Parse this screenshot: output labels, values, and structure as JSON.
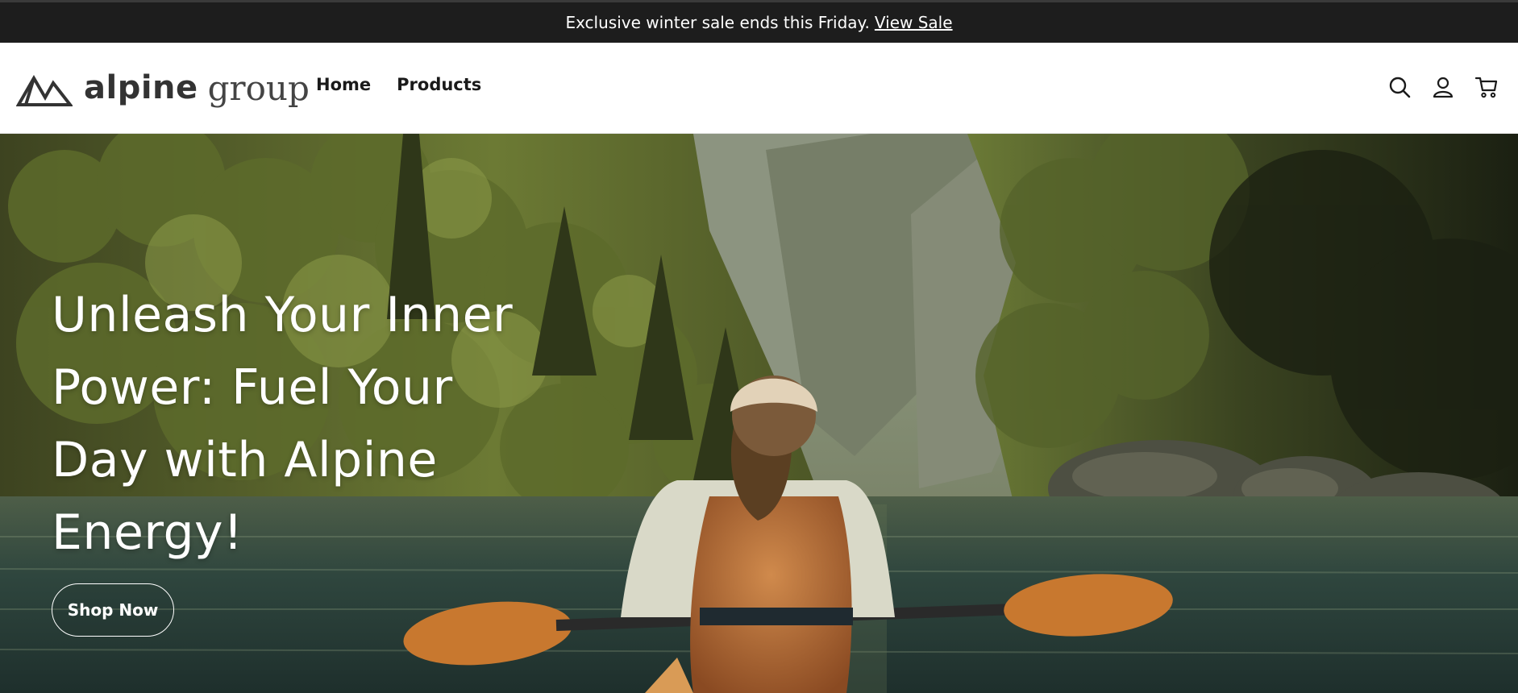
{
  "announcement": {
    "text": "Exclusive winter sale ends this Friday.",
    "link_label": "View Sale"
  },
  "header": {
    "logo_word_1": "alpine",
    "logo_word_2": "group",
    "nav": [
      {
        "label": "Home"
      },
      {
        "label": "Products"
      }
    ],
    "icons": [
      "search-icon",
      "account-icon",
      "cart-icon"
    ]
  },
  "hero": {
    "title_lines": [
      "Unleash Your Inner",
      "Power: Fuel Your",
      "Day with Alpine",
      "Energy!"
    ],
    "button_label": "Shop Now"
  },
  "colors": {
    "announcement_bg": "#1d1d1d",
    "accent_paddle": "#d27a2a",
    "forest_green": "#5a6a2e",
    "water": "#2f4a42"
  }
}
